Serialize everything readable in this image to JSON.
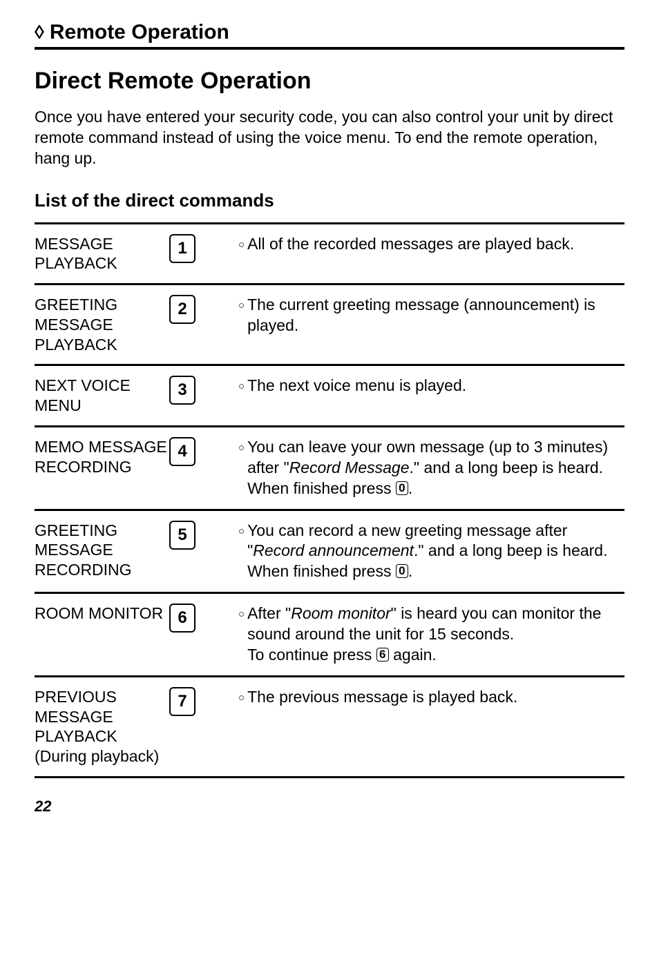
{
  "chapter": {
    "icon": "◊",
    "title": "Remote Operation"
  },
  "section": {
    "title": "Direct Remote Operation",
    "intro": "Once you have entered your security code, you can also control your unit by direct remote command instead of using the voice menu. To end the remote operation, hang up."
  },
  "subsection": {
    "title": "List of the direct commands"
  },
  "commands": [
    {
      "name": "MESSAGE PLAYBACK",
      "key": "1",
      "desc_a": "All of the recorded messages are played back."
    },
    {
      "name": "GREETING MESSAGE PLAYBACK",
      "key": "2",
      "desc_a": "The current greeting message (announcement) is played."
    },
    {
      "name": "NEXT VOICE MENU",
      "key": "3",
      "desc_a": "The next voice menu is played."
    },
    {
      "name": "MEMO MESSAGE RECORDING",
      "key": "4",
      "desc_a": "You can leave your own message (up to 3 minutes) after \"",
      "desc_italic": "Record Message",
      "desc_b": ".\" and a long beep is heard.",
      "desc_c": "When finished press ",
      "desc_key": "0",
      "desc_d": "."
    },
    {
      "name": "GREETING MESSAGE RECORDING",
      "key": "5",
      "desc_a": "You can record a new greeting message after \"",
      "desc_italic": "Record announcement",
      "desc_b": ".\" and a long beep is heard.",
      "desc_c": "When finished press ",
      "desc_key": "0",
      "desc_d": "."
    },
    {
      "name": "ROOM MONITOR",
      "key": "6",
      "desc_a": "After \"",
      "desc_italic": "Room monitor",
      "desc_b": "\" is heard you can monitor the sound around the unit for 15 seconds.",
      "desc_c": "To continue press ",
      "desc_key": "6",
      "desc_d": " again."
    },
    {
      "name": "PREVIOUS MESSAGE PLAYBACK (During playback)",
      "key": "7",
      "desc_a": "The previous message is played back."
    }
  ],
  "page_number": "22"
}
